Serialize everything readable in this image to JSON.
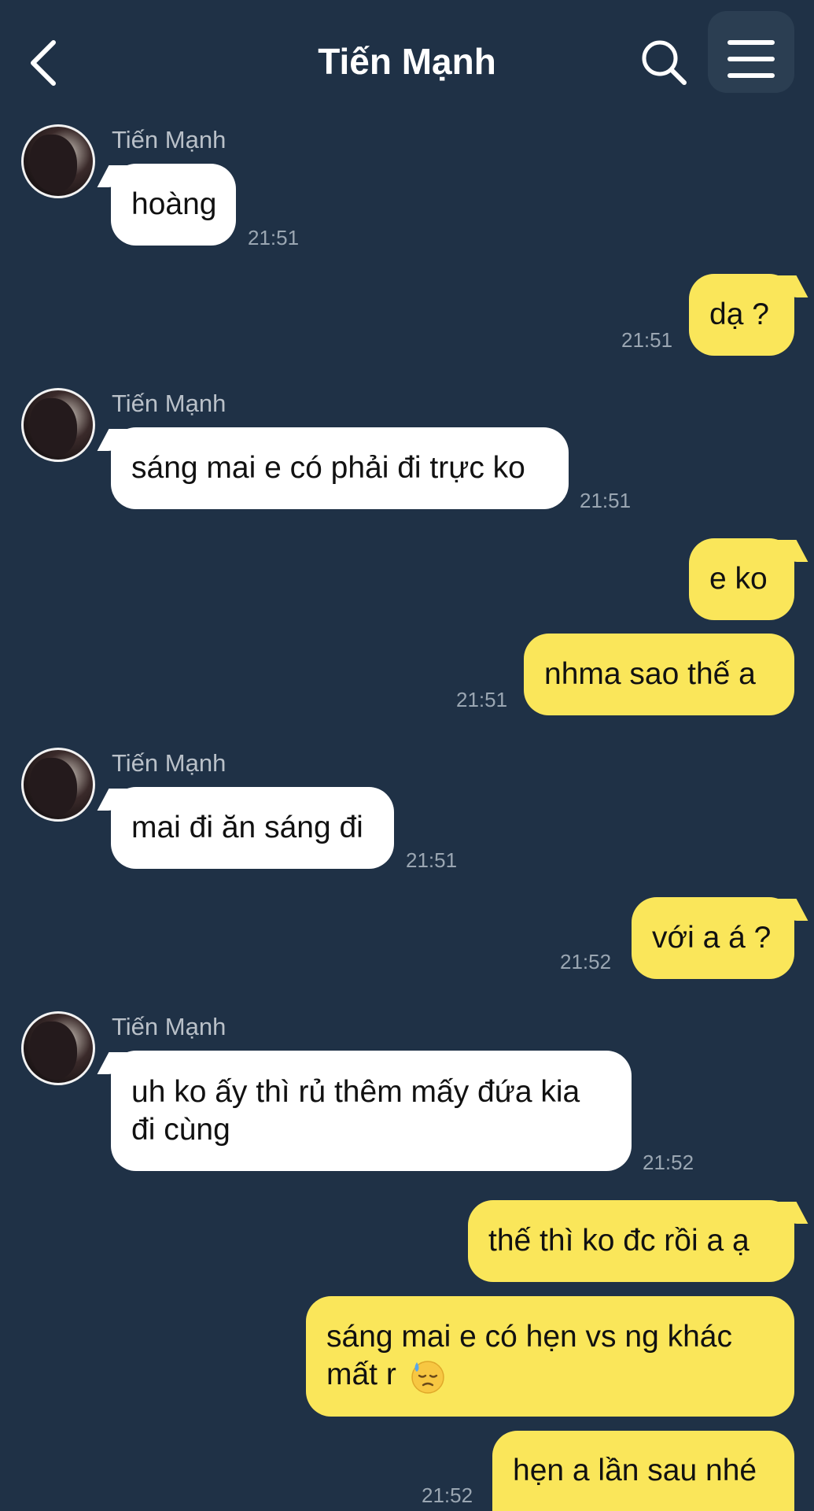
{
  "header": {
    "title": "Tiến Mạnh",
    "back_icon": "chevron-left-icon",
    "search_icon": "search-icon",
    "menu_icon": "hamburger-menu-icon"
  },
  "contact": {
    "name": "Tiến Mạnh"
  },
  "messages": [
    {
      "direction": "in",
      "text": "hoàng",
      "time": "21:51",
      "show_sender": true
    },
    {
      "direction": "out",
      "text": "dạ ?",
      "time": "21:51"
    },
    {
      "direction": "in",
      "text": "sáng mai e có phải đi trực ko",
      "time": "21:51",
      "show_sender": true
    },
    {
      "direction": "out",
      "text": "e ko",
      "time": ""
    },
    {
      "direction": "out",
      "text": "nhma sao thế a",
      "time": "21:51"
    },
    {
      "direction": "in",
      "text": "mai đi ăn sáng đi",
      "time": "21:51",
      "show_sender": true
    },
    {
      "direction": "out",
      "text": "với a á ?",
      "time": "21:52"
    },
    {
      "direction": "in",
      "text": "uh ko ấy thì rủ thêm mấy đứa kia đi cùng",
      "time": "21:52",
      "show_sender": true
    },
    {
      "direction": "out",
      "text": "thế thì ko đc rồi a ạ",
      "time": ""
    },
    {
      "direction": "out",
      "text": "sáng mai e có hẹn vs ng khác mất r",
      "emoji": "downcast-face-with-sweat-icon",
      "time": ""
    },
    {
      "direction": "out",
      "text": "hẹn a lần sau nhé",
      "time": "21:52"
    }
  ],
  "colors": {
    "background": "#1f3146",
    "incoming_bubble": "#ffffff",
    "outgoing_bubble": "#fae65a",
    "timestamp": "#9aa6b2",
    "sender_name": "#b9c0c8"
  }
}
